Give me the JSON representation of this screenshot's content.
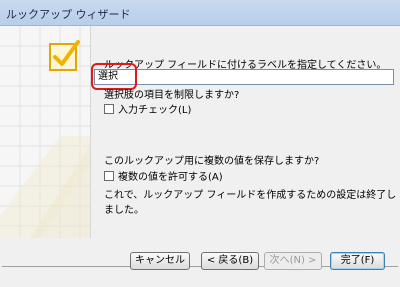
{
  "window": {
    "title": "ルックアップ ウィザード"
  },
  "wizard": {
    "prompt": "ルックアップ フィールドに付けるラベルを指定してください。",
    "label_value": "選択",
    "restrict_question": "選択肢の項目を制限しますか?",
    "input_check_label": "入力チェック(L)",
    "multi_question": "このルックアップ用に複数の値を保存しますか?",
    "multi_allow_label": "複数の値を許可する(A)",
    "finish_text": "これで、ルックアップ フィールドを作成するための設定は終了しました。"
  },
  "buttons": {
    "cancel": "キャンセル",
    "back": "< 戻る(B)",
    "next": "次へ(N) >",
    "finish": "完了(F)"
  },
  "colors": {
    "highlight": "#e01a1a",
    "accent": "#f0b400"
  }
}
